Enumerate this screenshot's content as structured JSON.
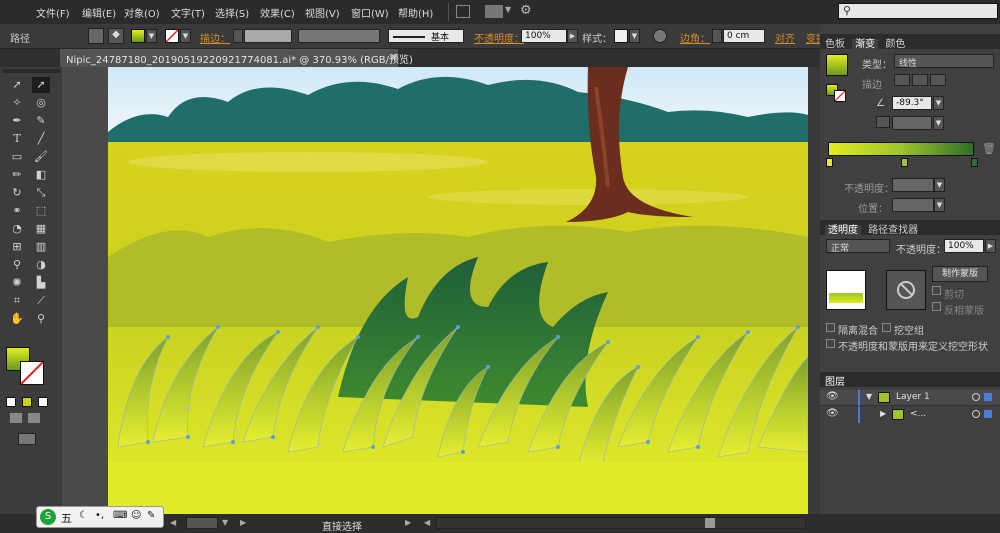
{
  "menubar": {
    "items": [
      "文件(F)",
      "编辑(E)",
      "对象(O)",
      "文字(T)",
      "选择(S)",
      "效果(C)",
      "视图(V)",
      "窗口(W)",
      "帮助(H)"
    ]
  },
  "control_bar": {
    "object_type": "路径",
    "stroke_label": "描边：",
    "brush_label": "基本",
    "opacity_label": "不透明度：",
    "opacity_value": "100%",
    "style_label": "样式：",
    "corner_label": "边角：",
    "corner_value": "0 cm",
    "align_label": "对齐",
    "transform_label": "变换"
  },
  "document": {
    "tab_title": "Nipic_24787180_20190519220921774081.ai* @ 370.93% (RGB/预览)",
    "close_glyph": "×"
  },
  "gradient_panel": {
    "tabs": [
      "色板",
      "渐变",
      "颜色"
    ],
    "type_label": "类型：",
    "type_value": "线性",
    "stroke_label": "描边",
    "angle_value": "-89.3°",
    "opacity_label": "不透明度：",
    "location_label": "位置："
  },
  "transparency_panel": {
    "tabs": [
      "透明度",
      "路径查找器"
    ],
    "blend_mode": "正常",
    "opacity_label": "不透明度：",
    "opacity_value": "100%",
    "make_mask_button": "制作蒙版",
    "clip_label": "剪切",
    "invert_mask_label": "反相蒙版",
    "isolate_blending_label": "隔离混合",
    "knockout_group_label": "挖空组",
    "opacity_mask_label": "不透明度和蒙版用来定义挖空形状"
  },
  "layers_panel": {
    "title": "图层",
    "layers": [
      {
        "name": "Layer 1"
      },
      {
        "name": "<..."
      }
    ]
  },
  "status_bar": {
    "tool_name": "直接选择",
    "ime_label": "五"
  },
  "colors": {
    "accent_orange": "#d98b2b",
    "gradient_start": "#e2ec1c",
    "gradient_end": "#2e6e2a",
    "layer_blue": "#4a7bd6"
  },
  "icons": [
    "selection-tool-icon",
    "direct-selection-icon",
    "pen-icon",
    "type-icon",
    "brush-icon",
    "eye-icon",
    "trash-icon"
  ]
}
